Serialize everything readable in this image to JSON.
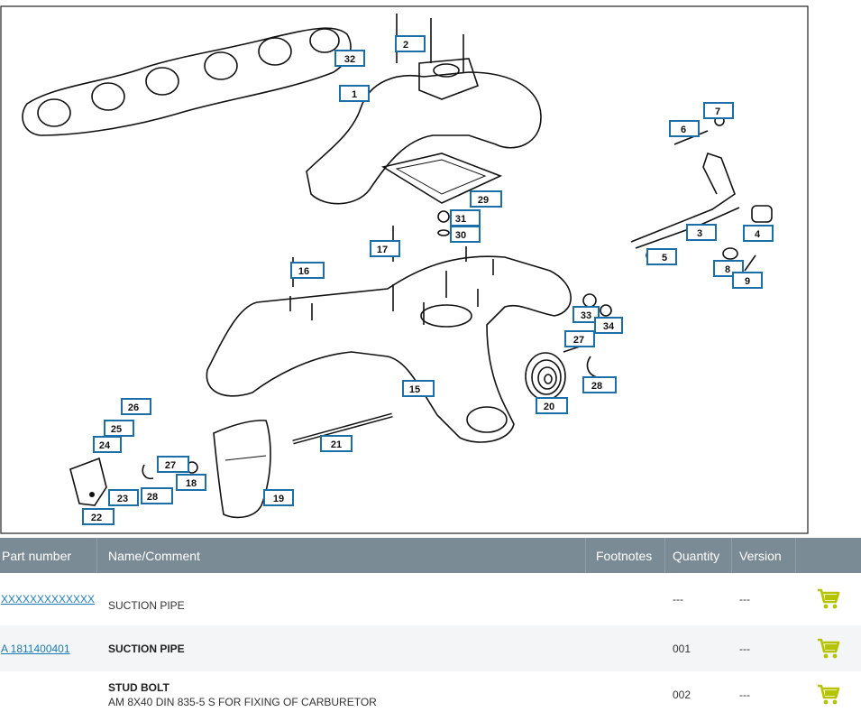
{
  "diagram": {
    "callouts": [
      "1",
      "2",
      "32",
      "3",
      "4",
      "5",
      "6",
      "7",
      "8",
      "9",
      "16",
      "17",
      "29",
      "31",
      "30",
      "33",
      "34",
      "27",
      "28",
      "20",
      "15",
      "21",
      "19",
      "26",
      "25",
      "24",
      "27",
      "18",
      "28",
      "23",
      "22"
    ]
  },
  "table": {
    "headers": {
      "part_number": "Part number",
      "name_comment": "Name/Comment",
      "footnotes": "Footnotes",
      "quantity": "Quantity",
      "version": "Version"
    },
    "rows": [
      {
        "part_number": "XXXXXXXXXXXXX",
        "name": "SUCTION PIPE",
        "comment": "",
        "footnotes": "",
        "quantity": "---",
        "version": "---"
      },
      {
        "part_number": "A 1811400401",
        "name": "SUCTION PIPE",
        "comment": "",
        "footnotes": "",
        "quantity": "001",
        "version": "---"
      },
      {
        "part_number": "",
        "name": "STUD BOLT",
        "comment": "AM 8X40 DIN 835-5 S FOR FIXING OF CARBURETOR",
        "footnotes": "",
        "quantity": "002",
        "version": "---"
      }
    ],
    "cart_icon": "shopping-cart-icon",
    "cart_color": "#b5c400",
    "header_color": "#7b8b96",
    "link_color": "#1a7ab8"
  }
}
